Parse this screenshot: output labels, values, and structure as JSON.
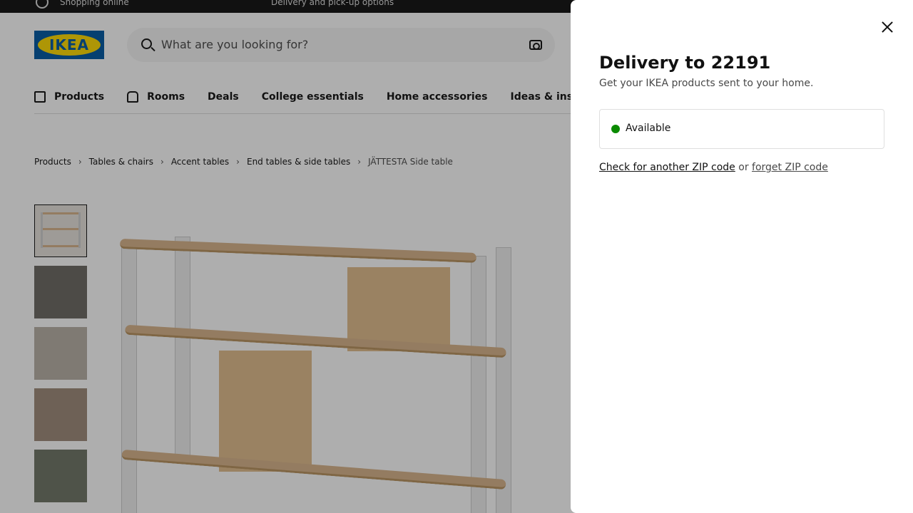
{
  "topbar": {
    "left_text": "Shopping online",
    "center_text": "Delivery and pick-up options"
  },
  "logo": {
    "text": "IKEA"
  },
  "search": {
    "placeholder": "What are you looking for?"
  },
  "nav": {
    "items": [
      {
        "label": "Products",
        "icon": "box-icon"
      },
      {
        "label": "Rooms",
        "icon": "house-icon"
      },
      {
        "label": "Deals"
      },
      {
        "label": "College essentials"
      },
      {
        "label": "Home accessories"
      },
      {
        "label": "Ideas & inspiration"
      }
    ]
  },
  "breadcrumb": {
    "items": [
      "Products",
      "Tables & chairs",
      "Accent tables",
      "End tables & side tables"
    ],
    "current": "JÄTTESTA Side table"
  },
  "modal": {
    "title": "Delivery to 22191",
    "subtitle": "Get your IKEA products sent to your home.",
    "status": "Available",
    "status_color": "#0a8a00",
    "link_check": "Check for another ZIP code",
    "link_or": " or ",
    "link_forget": "forget ZIP code"
  }
}
